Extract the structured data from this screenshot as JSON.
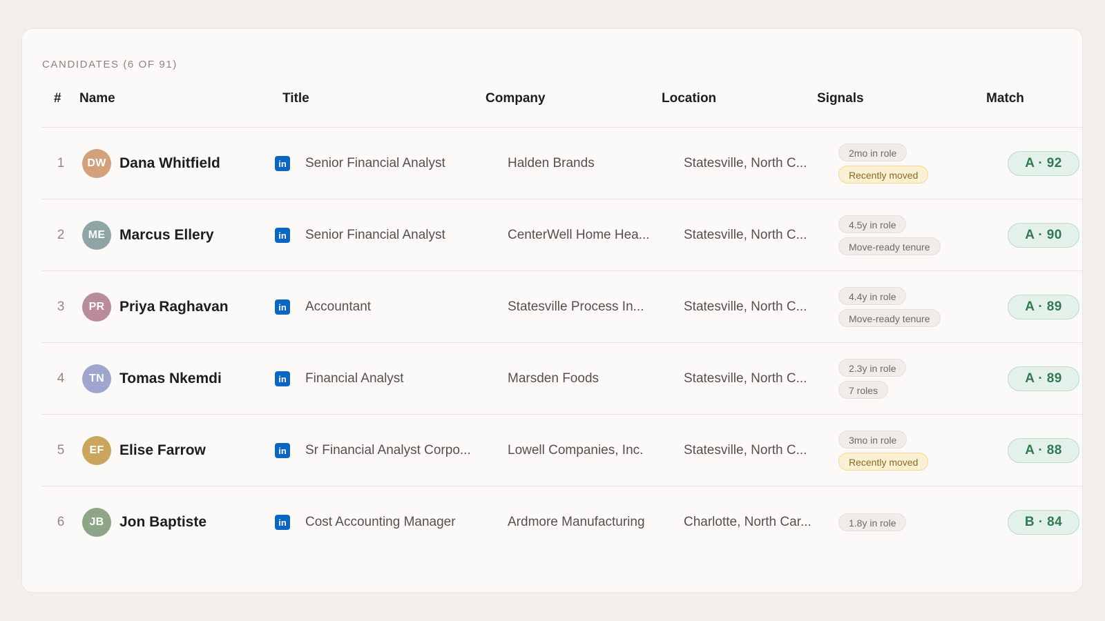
{
  "section": {
    "label": "CANDIDATES (6 OF 91)"
  },
  "columns": {
    "index": "#",
    "name": "Name",
    "title": "Title",
    "company": "Company",
    "location": "Location",
    "signals": "Signals",
    "match": "Match"
  },
  "colors": {
    "background": "#f2efeb",
    "card": "#fcfaf8",
    "linkedin": "#0b66c2",
    "match_green": "#2f7a51",
    "warn_chip": "#fcf0d4"
  },
  "rows": [
    {
      "index": "1",
      "initials": "DW",
      "avatar_color": "#d2a07a",
      "name": "Dana Whitfield",
      "linkedin": "in",
      "title": "Senior Financial Analyst",
      "company": "Halden Brands",
      "location": "Statesville, North C...",
      "signals": [
        {
          "label": "2mo in role",
          "kind": "neutral"
        },
        {
          "label": "Recently moved",
          "kind": "warn"
        }
      ],
      "match": "A · 92"
    },
    {
      "index": "2",
      "initials": "ME",
      "avatar_color": "#8fa5a5",
      "name": "Marcus Ellery",
      "linkedin": "in",
      "title": "Senior Financial Analyst",
      "company": "CenterWell Home Hea...",
      "location": "Statesville, North C...",
      "signals": [
        {
          "label": "4.5y in role",
          "kind": "neutral"
        },
        {
          "label": "Move-ready tenure",
          "kind": "neutral"
        }
      ],
      "match": "A · 90"
    },
    {
      "index": "3",
      "initials": "PR",
      "avatar_color": "#b98b9c",
      "name": "Priya Raghavan",
      "linkedin": "in",
      "title": "Accountant",
      "company": "Statesville Process In...",
      "location": "Statesville, North C...",
      "signals": [
        {
          "label": "4.4y in role",
          "kind": "neutral"
        },
        {
          "label": "Move-ready tenure",
          "kind": "neutral"
        }
      ],
      "match": "A · 89"
    },
    {
      "index": "4",
      "initials": "TN",
      "avatar_color": "#9ea6cd",
      "name": "Tomas Nkemdi",
      "linkedin": "in",
      "title": "Financial Analyst",
      "company": "Marsden Foods",
      "location": "Statesville, North C...",
      "signals": [
        {
          "label": "2.3y in role",
          "kind": "neutral"
        },
        {
          "label": "7 roles",
          "kind": "neutral"
        }
      ],
      "match": "A · 89"
    },
    {
      "index": "5",
      "initials": "EF",
      "avatar_color": "#c9a55e",
      "name": "Elise Farrow",
      "linkedin": "in",
      "title": "Sr Financial Analyst Corpo...",
      "company": "Lowell Companies, Inc.",
      "location": "Statesville, North C...",
      "signals": [
        {
          "label": "3mo in role",
          "kind": "neutral"
        },
        {
          "label": "Recently moved",
          "kind": "warn"
        }
      ],
      "match": "A · 88"
    },
    {
      "index": "6",
      "initials": "JB",
      "avatar_color": "#8ea588",
      "name": "Jon Baptiste",
      "linkedin": "in",
      "title": "Cost Accounting Manager",
      "company": "Ardmore Manufacturing",
      "location": "Charlotte, North Car...",
      "signals": [
        {
          "label": "1.8y in role",
          "kind": "neutral"
        }
      ],
      "match": "B · 84"
    }
  ]
}
